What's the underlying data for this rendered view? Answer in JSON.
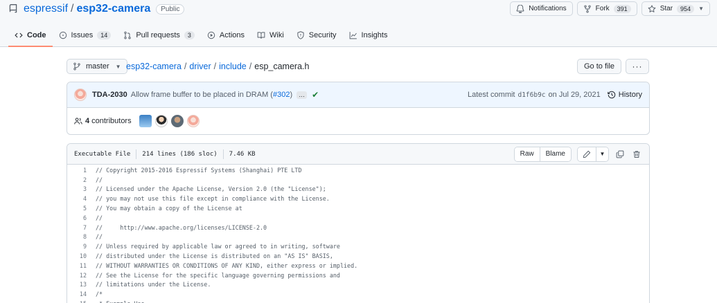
{
  "repo": {
    "owner": "espressif",
    "separator": "/",
    "name": "esp32-camera",
    "visibility": "Public"
  },
  "actions": {
    "notifications": "Notifications",
    "fork_label": "Fork",
    "fork_count": "391",
    "star_label": "Star",
    "star_count": "954"
  },
  "tabs": [
    {
      "label": "Code"
    },
    {
      "label": "Issues",
      "count": "14"
    },
    {
      "label": "Pull requests",
      "count": "3"
    },
    {
      "label": "Actions"
    },
    {
      "label": "Wiki"
    },
    {
      "label": "Security"
    },
    {
      "label": "Insights"
    }
  ],
  "breadcrumb": {
    "branch": "master",
    "parts": [
      "esp32-camera",
      "driver",
      "include"
    ],
    "current": "esp_camera.h",
    "goto_file": "Go to file",
    "more": "···"
  },
  "commit": {
    "author": "TDA-2030",
    "message": "Allow frame buffer to be placed in DRAM (",
    "pr": "#302",
    "message_end": ")",
    "ellipsis": "…",
    "latest_label": "Latest commit",
    "sha": "d1f6b9c",
    "date": "on Jul 29, 2021",
    "history": "History"
  },
  "contributors": {
    "count": "4",
    "label": "contributors"
  },
  "file": {
    "type": "Executable File",
    "lines": "214 lines (186 sloc)",
    "size": "7.46 KB",
    "raw": "Raw",
    "blame": "Blame"
  },
  "code_lines": [
    {
      "n": "1",
      "text": "// Copyright 2015-2016 Espressif Systems (Shanghai) PTE LTD"
    },
    {
      "n": "2",
      "text": "//"
    },
    {
      "n": "3",
      "text": "// Licensed under the Apache License, Version 2.0 (the \"License\");"
    },
    {
      "n": "4",
      "text": "// you may not use this file except in compliance with the License."
    },
    {
      "n": "5",
      "text": "// You may obtain a copy of the License at"
    },
    {
      "n": "6",
      "text": "//"
    },
    {
      "n": "7",
      "text": "//     http://www.apache.org/licenses/LICENSE-2.0"
    },
    {
      "n": "8",
      "text": "//"
    },
    {
      "n": "9",
      "text": "// Unless required by applicable law or agreed to in writing, software"
    },
    {
      "n": "10",
      "text": "// distributed under the License is distributed on an \"AS IS\" BASIS,"
    },
    {
      "n": "11",
      "text": "// WITHOUT WARRANTIES OR CONDITIONS OF ANY KIND, either express or implied."
    },
    {
      "n": "12",
      "text": "// See the License for the specific language governing permissions and"
    },
    {
      "n": "13",
      "text": "// limitations under the License."
    },
    {
      "n": "14",
      "text": "/*"
    },
    {
      "n": "15",
      "text": " * Example Use"
    }
  ],
  "colors": {
    "link": "#0969da",
    "tab_underline": "#fd8c73",
    "success": "#1a7f37"
  }
}
